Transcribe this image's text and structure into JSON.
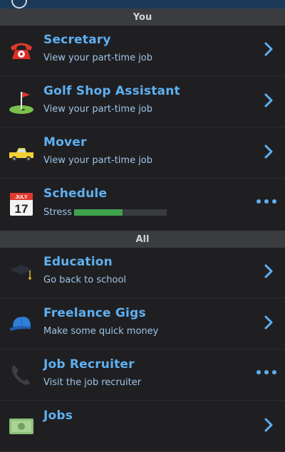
{
  "sections": {
    "you": "You",
    "all": "All"
  },
  "rows": [
    {
      "title": "Secretary",
      "subtitle": "View your part-time job",
      "icon": "red-telephone-icon",
      "action": "chevron"
    },
    {
      "title": "Golf Shop Assistant",
      "subtitle": "View your part-time job",
      "icon": "golf-flag-icon",
      "action": "chevron"
    },
    {
      "title": "Mover",
      "subtitle": "View your part-time job",
      "icon": "pickup-truck-icon",
      "action": "chevron"
    },
    {
      "title": "Schedule",
      "subtitle": "Stress",
      "icon": "calendar-icon",
      "action": "more"
    },
    {
      "title": "Education",
      "subtitle": "Go back to school",
      "icon": "graduation-cap-icon",
      "action": "chevron"
    },
    {
      "title": "Freelance Gigs",
      "subtitle": "Make some quick money",
      "icon": "baseball-cap-icon",
      "action": "chevron"
    },
    {
      "title": "Job Recruiter",
      "subtitle": "Visit the job recruiter",
      "icon": "phone-receiver-icon",
      "action": "more"
    },
    {
      "title": "Jobs",
      "subtitle": "",
      "icon": "money-icon",
      "action": "chevron"
    }
  ],
  "calendar": {
    "month": "JULY",
    "day": "17"
  },
  "stress_level": 0.52,
  "colors": {
    "accent": "#5fb0f0",
    "stress": "#3fa34d",
    "background": "#1f1f22",
    "header": "#3b3c40"
  }
}
